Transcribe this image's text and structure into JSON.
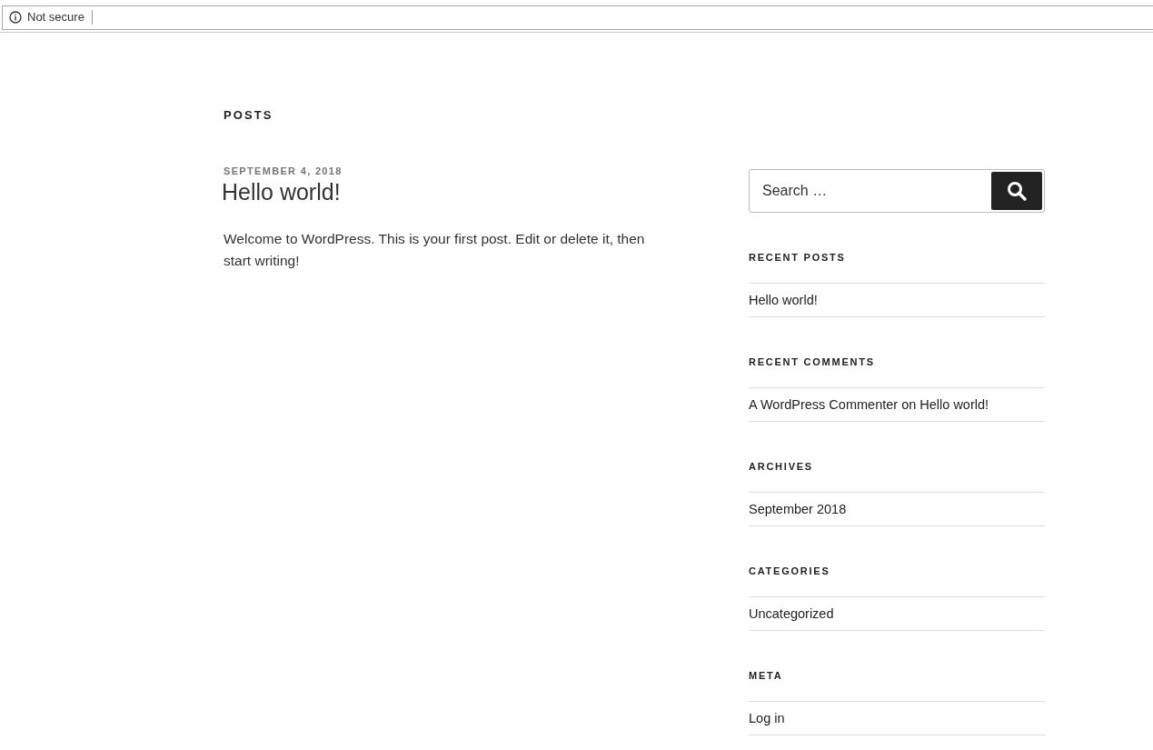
{
  "browser": {
    "security_label": "Not secure"
  },
  "page": {
    "heading": "POSTS"
  },
  "posts": [
    {
      "date": "SEPTEMBER 4, 2018",
      "title": "Hello world!",
      "excerpt": "Welcome to WordPress. This is your first post. Edit or delete it, then start writing!"
    }
  ],
  "sidebar": {
    "search": {
      "placeholder": "Search …"
    },
    "widgets": [
      {
        "kind": "links",
        "title": "RECENT POSTS",
        "items": [
          "Hello world!"
        ]
      },
      {
        "kind": "comments",
        "title": "RECENT COMMENTS",
        "items": [
          {
            "author": "A WordPress Commenter",
            "connector": "on",
            "post": "Hello world!"
          }
        ]
      },
      {
        "kind": "links",
        "title": "ARCHIVES",
        "items": [
          "September 2018"
        ]
      },
      {
        "kind": "links",
        "title": "CATEGORIES",
        "items": [
          "Uncategorized"
        ]
      },
      {
        "kind": "links",
        "title": "META",
        "items": [
          "Log in"
        ]
      }
    ]
  }
}
